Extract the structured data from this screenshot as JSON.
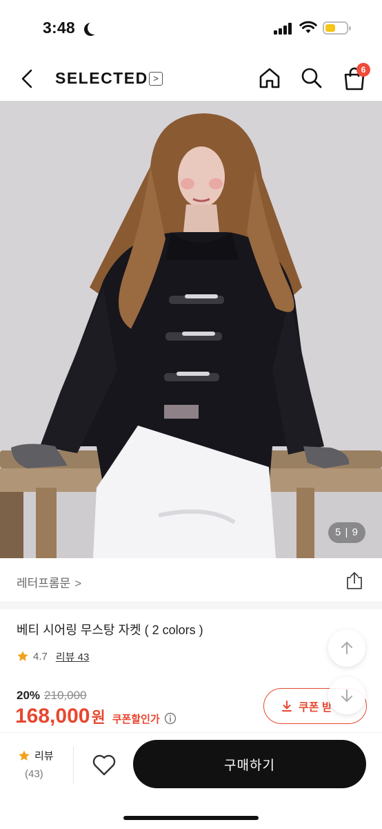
{
  "status": {
    "time": "3:48",
    "moon_icon": "moon-icon",
    "battery_color": "#f5c518"
  },
  "nav": {
    "brand": "SELECTED",
    "brand_chevron": ">",
    "cart_count": "6"
  },
  "hero": {
    "counter": "5 | 9"
  },
  "product": {
    "brand_name": "레터프롬문",
    "brand_chevron": ">",
    "title": "베티 시어링 무스탕 자켓 ( 2 colors )",
    "rating": "4.7",
    "review_link": "리뷰 43",
    "discount_rate": "20%",
    "original_price": "210,000",
    "sale_price": "168,000",
    "price_unit": "원",
    "coupon_price_label": "쿠폰할인가",
    "coupon_button": "쿠폰 받"
  },
  "bottom_bar": {
    "review_label": "리뷰",
    "review_count": "(43)",
    "buy_button": "구매하기"
  },
  "colors": {
    "accent": "#e8472f",
    "badge": "#ef4a3a",
    "buy_button_bg": "#111111",
    "star": "#f2a11b"
  }
}
